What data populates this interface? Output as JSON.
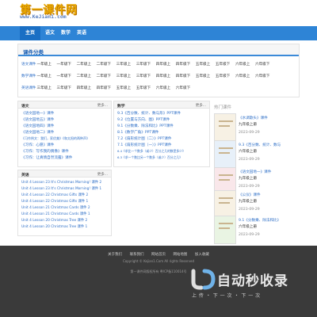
{
  "site": {
    "logo_main": "第一课件网",
    "logo_sub": "www.KeJian1.com"
  },
  "nav": {
    "items": [
      "主页",
      "语文",
      "数学",
      "英语"
    ]
  },
  "category": {
    "title": "课件分类",
    "rows": [
      {
        "name": "语文课件",
        "items": [
          "一年级上",
          "一年级下",
          "二年级上",
          "二年级下",
          "三年级上",
          "三年级下",
          "四年级上",
          "四年级下",
          "五年级上",
          "五年级下",
          "六年级上",
          "六年级下"
        ]
      },
      {
        "name": "数学课件",
        "items": [
          "一年级上",
          "一年级下",
          "二年级上",
          "二年级下",
          "三年级上",
          "三年级下",
          "四年级上",
          "四年级下",
          "五年级上",
          "五年级下",
          "六年级上",
          "六年级下"
        ]
      },
      {
        "name": "英语课件",
        "items": [
          "三年级上",
          "三年级下",
          "四年级上",
          "四年级下",
          "五年级上",
          "五年级下",
          "六年级上",
          "六年级下"
        ]
      }
    ]
  },
  "chinese_panel": {
    "title": "语文",
    "more": "更多...",
    "items": [
      "《语文园地一》课件",
      "《语文园地五》课件",
      "《语文园地四》课件",
      "《语文园地二》课件",
      "《习作例文：我们，家优美》《和太阳的两种声》",
      "《习作：心愿》课件",
      "《习作：写作我的偶像》课件",
      "《习作：让真情自然流露》课件"
    ]
  },
  "math_panel": {
    "title": "数学",
    "more": "更多...",
    "items": [
      "9.3《百分数、统计、数与形》PPT课件",
      "9.2《位置与方向、图》PPT课件",
      "9.1《分数乘、除法和比》PPT课件",
      "8.1《数学广角》PPT课件",
      "7.2《扇形统计图（二）》PPT课件",
      "7.1《扇形统计图（一）》PPT课件",
      "6.4《求比一个数多（或少）百分之几的数是多少》",
      "6.3《求一个数比另一个数多（或少）百分之几》"
    ]
  },
  "english_panel": {
    "title": "英语",
    "more": "更多...",
    "items": [
      "Unit 4 Lesson 23 It's Christmas Morning! 课件 2",
      "Unit 4 Lesson 23 It's Christmas Morning! 课件 1",
      "Unit 4 Lesson 22 Christmas Gifts 课件 2",
      "Unit 4 Lesson 22 Christmas Gifts 课件 1",
      "Unit 4 Lesson 21 Christmas Cards 课件 2",
      "Unit 4 Lesson 21 Christmas Cards 课件 1",
      "Unit 4 Lesson 20 Christmas Tree 课件 2",
      "Unit 4 Lesson 20 Christmas Tree 课件 1"
    ]
  },
  "sidebar": {
    "title": "热门课件",
    "cards": [
      {
        "title": "《水调歌头》课件",
        "sub": "九年级上册",
        "date": "2023-09-29"
      },
      {
        "title": "9.3《百分数、统计、数与",
        "sub": "六年级上册",
        "date": "2023-09-29"
      },
      {
        "title": "《语文园地一》课件",
        "sub": "九年级上册",
        "date": "2023-09-29"
      },
      {
        "title": "《公仪》课件",
        "sub": "九年级上册",
        "date": "2023-09-29"
      },
      {
        "title": "9.1《分数乘、除法和比》",
        "sub": "六年级上册",
        "date": "2023-09-29"
      }
    ]
  },
  "footer": {
    "links": [
      "关于我们",
      "联系我们",
      "网站首页",
      "网站地图",
      "加入收藏"
    ],
    "copyright": "Copyright © Kejian1.Com All rights Reserved",
    "line2": "第一课件网版权所有    粤ICP备110014号"
  },
  "watermark": {
    "text": "自动秒收录",
    "sub": "上 传 ・ 下 一 次 ・ 下 一 次"
  },
  "colors": {
    "nav": "#2e84d6",
    "accent": "#1a5fb4",
    "link": "#2e6fc7",
    "footer": "#3a3a3a",
    "logo": "#e8a800"
  }
}
